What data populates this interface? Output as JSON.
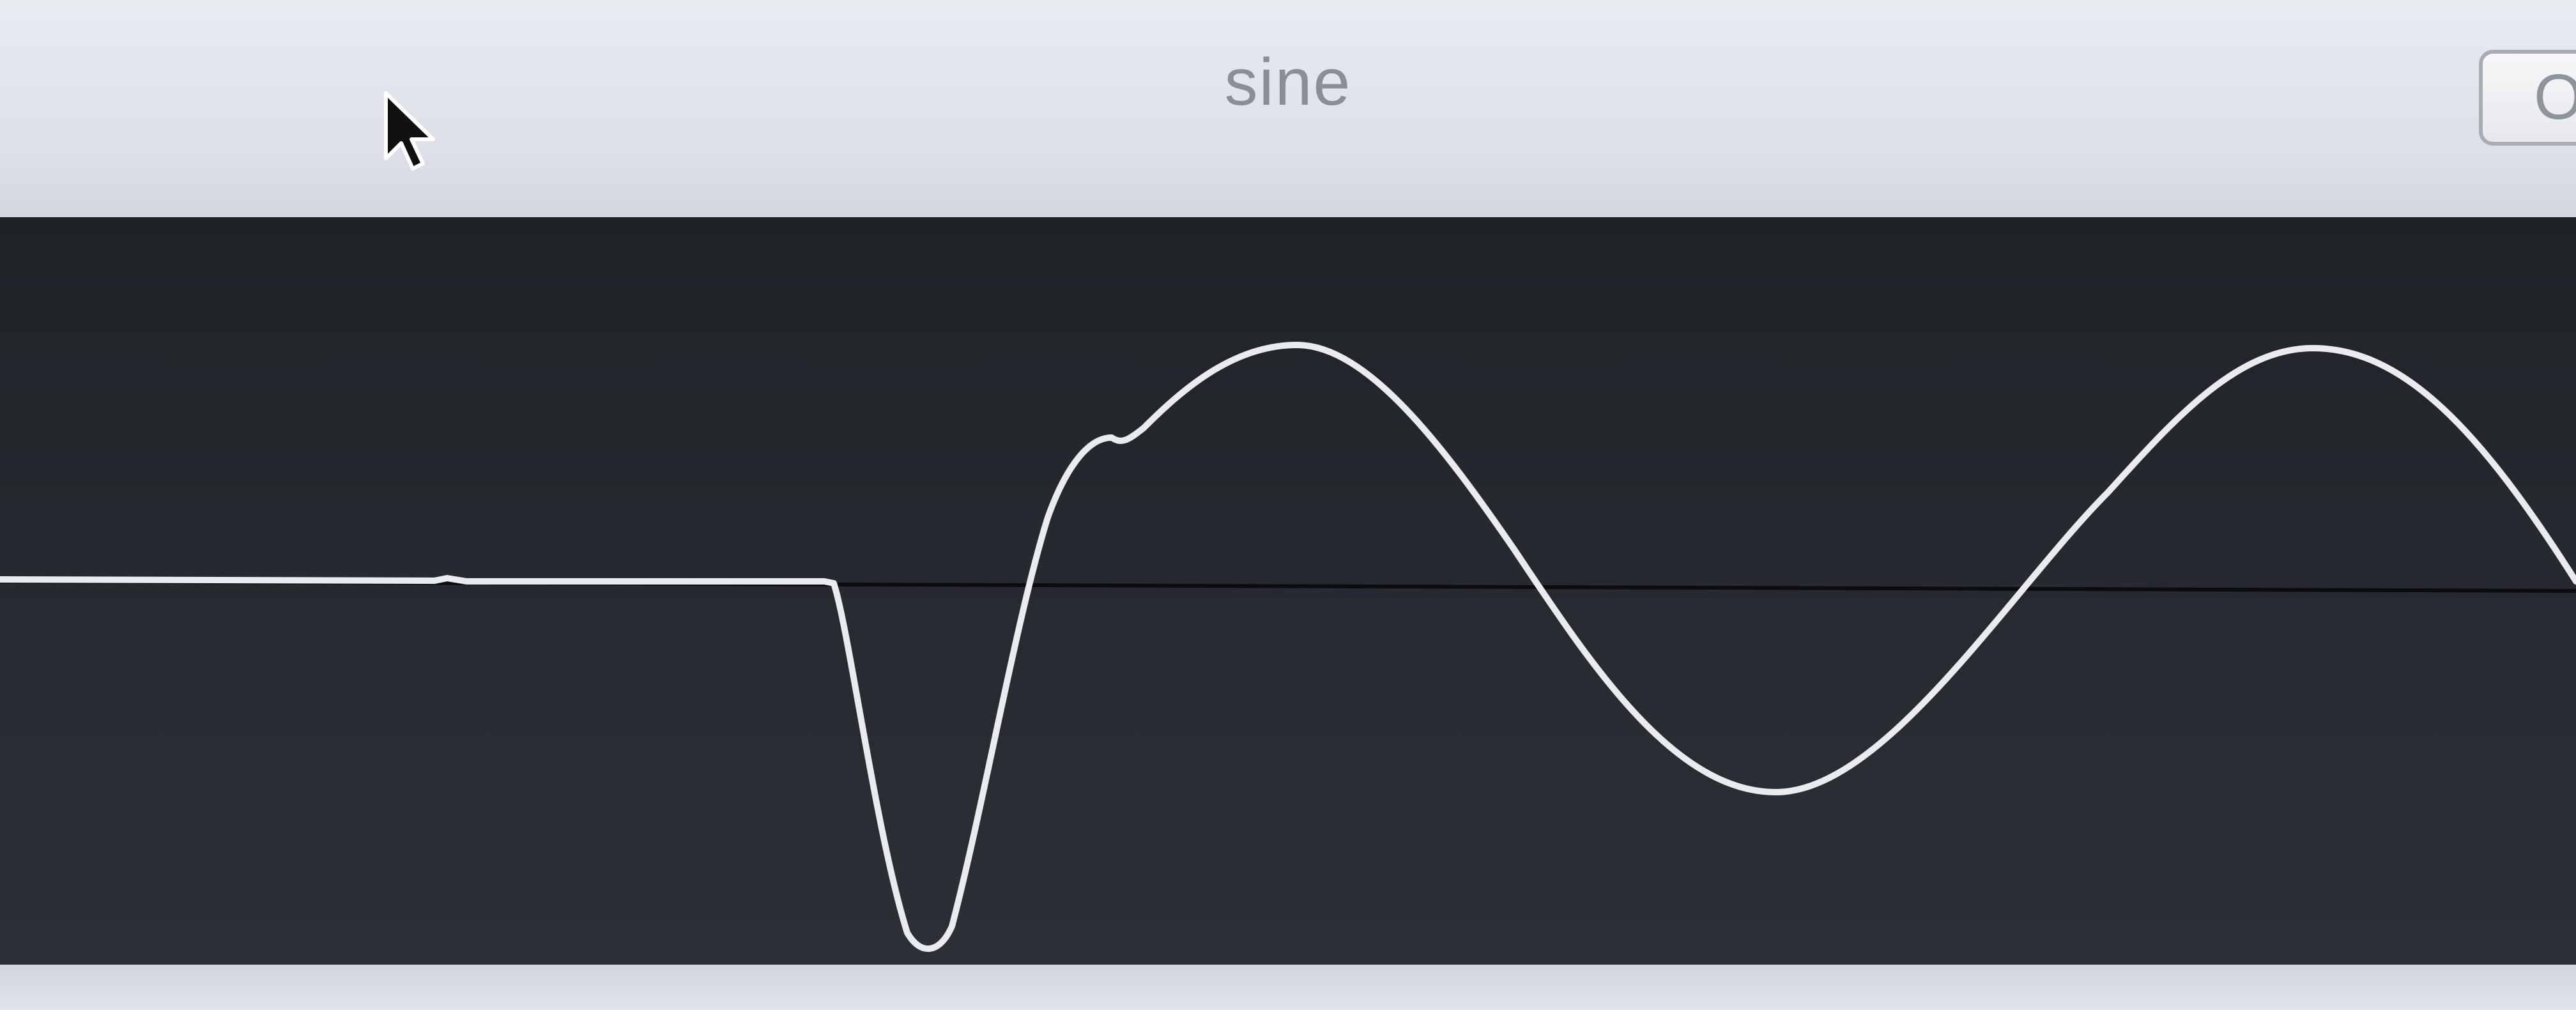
{
  "window": {
    "title": "sine",
    "button_label": "O"
  },
  "scope": {
    "trace_color": "#e9ebee",
    "baseline_color": "#0b0c0e",
    "background_color": "#23272d"
  },
  "icons": {
    "cursor": "mouse-pointer-icon"
  }
}
